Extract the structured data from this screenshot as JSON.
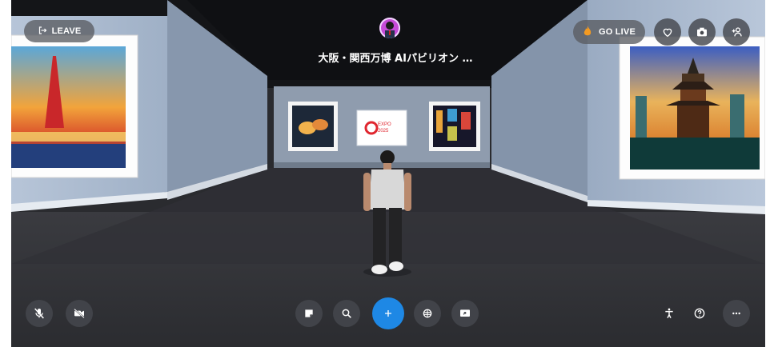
{
  "header": {
    "leave_label": "LEAVE",
    "space_title": "大阪・関西万博 AIパビリオン …",
    "go_live_label": "GO LIVE"
  },
  "artwork": {
    "expo_line1": "EXPO",
    "expo_line2": "2025"
  },
  "icons": {
    "leave": "exit-icon",
    "go_live": "fire-icon",
    "favorite": "heart-icon",
    "screenshot": "camera-icon",
    "invite": "add-person-icon",
    "mic": "mic-muted-icon",
    "camera": "camera-off-icon",
    "sticky_note": "note-icon",
    "search": "search-icon",
    "add": "plus-icon",
    "emotes": "emote-icon",
    "share_screen": "share-screen-icon",
    "accessibility": "accessibility-icon",
    "help": "help-icon",
    "more": "more-icon"
  },
  "colors": {
    "accent_blue": "#1e88e5",
    "toolbar_button": "#46484e",
    "wall": "#a8b8cc",
    "floor": "#2e2f33"
  }
}
